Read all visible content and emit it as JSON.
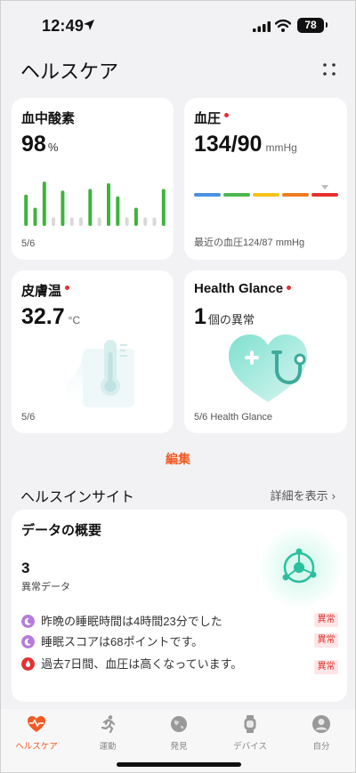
{
  "status_bar": {
    "time": "12:49",
    "battery": "78"
  },
  "header": {
    "title": "ヘルスケア"
  },
  "cards": {
    "spo2": {
      "title": "血中酸素",
      "value": "98",
      "unit": "%",
      "date": "5/6",
      "bar_levels": [
        0.55,
        0.32,
        0.78,
        0.15,
        0.62,
        0.15,
        0.15,
        0.65,
        0.15,
        0.75,
        0.52,
        0.15,
        0.32,
        0.15,
        0.15,
        0.65
      ],
      "bar_active": [
        true,
        true,
        true,
        false,
        true,
        false,
        false,
        true,
        false,
        true,
        true,
        false,
        true,
        false,
        false,
        true
      ]
    },
    "bp": {
      "title": "血圧",
      "value": "134/90",
      "unit": "mmHg",
      "footer": "最近の血圧124/87 mmHg",
      "scale_colors": [
        "#4a90e2",
        "#4cb84c",
        "#f6c21c",
        "#f07b1f",
        "#e5302f"
      ]
    },
    "temp": {
      "title": "皮膚温",
      "value": "32.7",
      "unit": "°C",
      "date": "5/6"
    },
    "glance": {
      "title": "Health Glance",
      "value": "1",
      "unit": "個の異常",
      "footer": "5/6 Health Glance"
    }
  },
  "edit_label": "編集",
  "insights": {
    "section_title": "ヘルスインサイト",
    "detail_link": "詳細を表示",
    "card_title": "データの概要",
    "count": "3",
    "count_label": "異常データ",
    "items": [
      {
        "text": "昨晩の睡眠時間は4時間23分でした",
        "tag": "異常",
        "icon": "moon-icon",
        "color": "#b57bdc"
      },
      {
        "text": "睡眠スコアは68ポイントです。",
        "tag": "異常",
        "icon": "moon-icon",
        "color": "#b57bdc"
      },
      {
        "text": "過去7日間、血圧は高くなっています。",
        "tag": "異常",
        "icon": "blood-drop-icon",
        "color": "#e5302f"
      }
    ]
  },
  "tabs": [
    {
      "label": "ヘルスケア",
      "icon": "heart-pulse-icon",
      "active": true
    },
    {
      "label": "運動",
      "icon": "runner-icon",
      "active": false
    },
    {
      "label": "発見",
      "icon": "globe-icon",
      "active": false
    },
    {
      "label": "デバイス",
      "icon": "watch-icon",
      "active": false
    },
    {
      "label": "自分",
      "icon": "person-icon",
      "active": false
    }
  ],
  "colors": {
    "accent": "#f15a24",
    "alert": "#e5302f",
    "bar_green": "#3cb43c",
    "bar_gray": "#d9d9d9"
  }
}
